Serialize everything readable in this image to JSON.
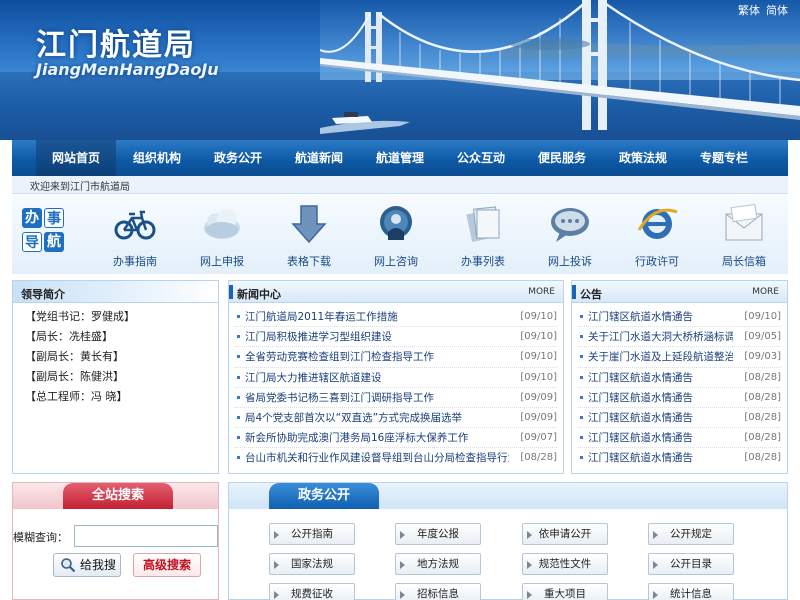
{
  "header": {
    "title": "江门航道局",
    "subtitle": "JiangMenHangDaoJu",
    "lang_traditional": "繁体",
    "lang_simplified": "简体"
  },
  "nav": {
    "items": [
      "网站首页",
      "组织机构",
      "政务公开",
      "航道新闻",
      "航道管理",
      "公众互动",
      "便民服务",
      "政策法规",
      "专题专栏"
    ],
    "active_index": 0
  },
  "welcome": "欢迎来到江门市航道局",
  "services": {
    "badge": [
      "办",
      "事",
      "导",
      "航"
    ],
    "items": [
      {
        "label": "办事指南",
        "icon": "bicycle-icon"
      },
      {
        "label": "网上申报",
        "icon": "cloud-icon"
      },
      {
        "label": "表格下载",
        "icon": "download-arrow-icon"
      },
      {
        "label": "网上咨询",
        "icon": "chat-person-icon"
      },
      {
        "label": "办事列表",
        "icon": "documents-icon"
      },
      {
        "label": "网上投诉",
        "icon": "speech-bubble-icon"
      },
      {
        "label": "行政许可",
        "icon": "ie-browser-icon"
      },
      {
        "label": "局长信箱",
        "icon": "envelope-icon"
      }
    ]
  },
  "leaders": {
    "title": "领导简介",
    "items": [
      "【党组书记：罗健成】",
      "【局长：冼桂盛】",
      "【副局长：黄长有】",
      "【副局长：陈健洪】",
      "【总工程师：冯 晓】"
    ]
  },
  "news": {
    "title": "新闻中心",
    "more": "MORE",
    "items": [
      {
        "title": "江门航道局2011年春运工作措施",
        "date": "[09/10]"
      },
      {
        "title": "江门局积极推进学习型组织建设",
        "date": "[09/10]"
      },
      {
        "title": "全省劳动竞赛检查组到江门检查指导工作",
        "date": "[09/10]"
      },
      {
        "title": "江门局大力推进辖区航道建设",
        "date": "[09/10]"
      },
      {
        "title": "省局党委书记杨三喜到江门调研指导工作",
        "date": "[09/09]"
      },
      {
        "title": "局4个党支部首次以“双直选”方式完成换届选举",
        "date": "[09/09]"
      },
      {
        "title": "新会所协助完成澳门港务局16座浮标大保养工作",
        "date": "[09/07]"
      },
      {
        "title": "台山市机关和行业作风建设督导组到台山分局检查指导行业作风建设",
        "date": "[08/28]"
      }
    ]
  },
  "notice": {
    "title": "公告",
    "more": "MORE",
    "items": [
      {
        "title": "江门辖区航道水情通告",
        "date": "[09/10]"
      },
      {
        "title": "关于江门水道大洞大桥桥涵标调整的通告",
        "date": "[09/05]"
      },
      {
        "title": "关于崖门水道及上延段航道整治工程施工的通告",
        "date": "[09/03]"
      },
      {
        "title": "江门辖区航道水情通告",
        "date": "[08/28]"
      },
      {
        "title": "江门辖区航道水情通告",
        "date": "[08/28]"
      },
      {
        "title": "江门辖区航道水情通告",
        "date": "[08/28]"
      },
      {
        "title": "江门辖区航道水情通告",
        "date": "[08/28]"
      },
      {
        "title": "江门辖区航道水情通告",
        "date": "[08/28]"
      }
    ]
  },
  "search": {
    "title": "全站搜索",
    "label": "模糊查询：",
    "value": "",
    "search_button": "给我搜",
    "advanced_button": "高级搜索"
  },
  "gov": {
    "title": "政务公开",
    "buttons": [
      "公开指南",
      "年度公报",
      "依申请公开",
      "公开规定",
      "国家法规",
      "地方法规",
      "规范性文件",
      "公开目录",
      "规费征收",
      "招标信息",
      "重大项目",
      "统计信息"
    ]
  }
}
